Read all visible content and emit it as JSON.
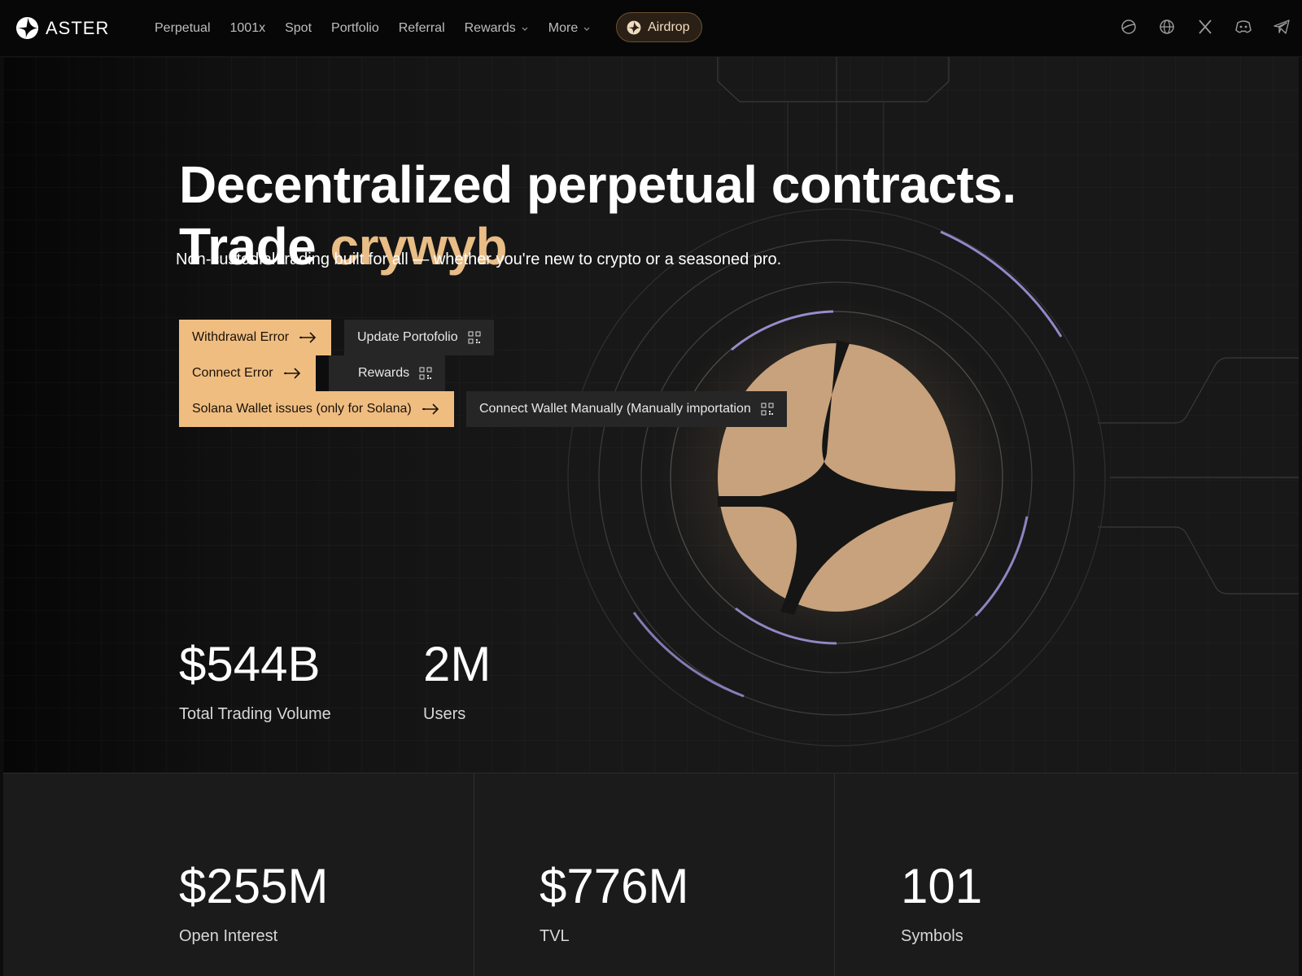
{
  "brand": {
    "name": "ASTER"
  },
  "nav": {
    "links": [
      {
        "label": "Perpetual"
      },
      {
        "label": "1001x"
      },
      {
        "label": "Spot"
      },
      {
        "label": "Portfolio"
      },
      {
        "label": "Referral"
      },
      {
        "label": "Rewards",
        "dropdown": true
      },
      {
        "label": "More",
        "dropdown": true
      }
    ],
    "airdrop_label": "Airdrop",
    "icons": [
      "planet-icon",
      "globe-icon",
      "x-icon",
      "discord-icon",
      "telegram-icon"
    ]
  },
  "hero": {
    "headline_line1": "Decentralized perpetual contracts.",
    "headline_line2_prefix": "Trade",
    "headline_line2_accent": "crywyb",
    "subtitle": "Non-custodial trading built for all — whether you're new to crypto or a seasoned pro.",
    "buttons": {
      "withdrawal_error": "Withdrawal Error",
      "update_portfolio": "Update Portofolio",
      "connect_error": "Connect Error",
      "rewards": "Rewards",
      "solana_issues": "Solana Wallet issues (only for Solana)",
      "connect_manually": "Connect Wallet Manually (Manually importation"
    },
    "stats": [
      {
        "value": "$544B",
        "label": "Total Trading Volume"
      },
      {
        "value": "2M",
        "label": "Users"
      }
    ]
  },
  "metrics": [
    {
      "value": "$255M",
      "label": "Open Interest"
    },
    {
      "value": "$776M",
      "label": "TVL"
    },
    {
      "value": "101",
      "label": "Symbols"
    }
  ],
  "colors": {
    "accent": "#f0bd81",
    "accent_text": "#e9bd86",
    "ring_highlight": "#a89be8",
    "background": "#181818"
  }
}
